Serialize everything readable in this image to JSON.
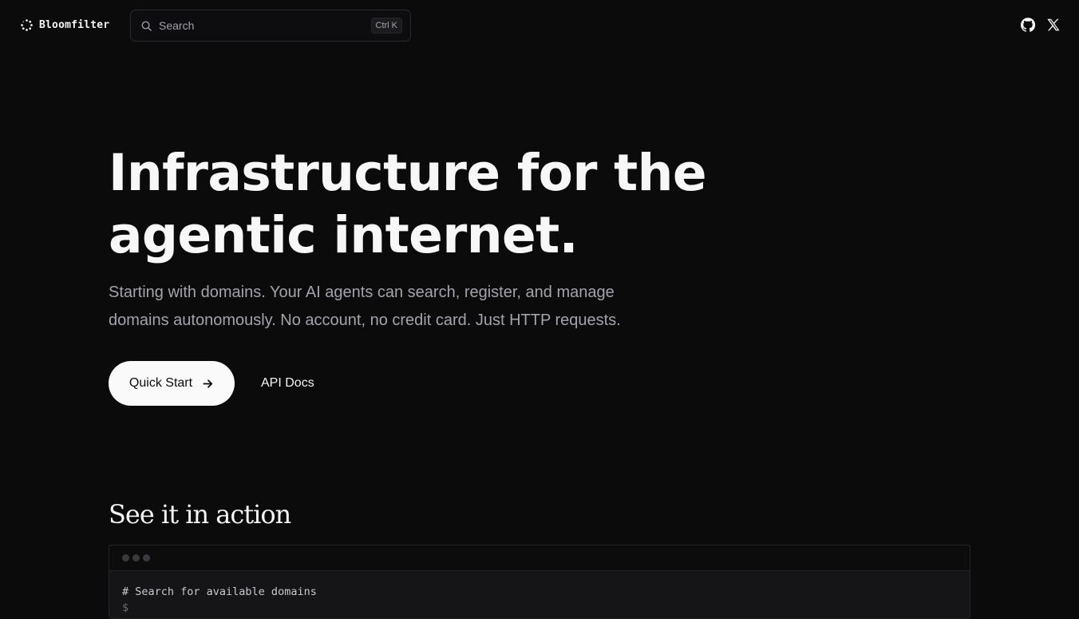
{
  "brand": {
    "name": "Bloomfilter",
    "icon": "dotted-circle-logo"
  },
  "search": {
    "label": "Search",
    "shortcut": "Ctrl K",
    "icon": "search-icon"
  },
  "social": {
    "github": "github-icon",
    "x": "x-icon"
  },
  "hero": {
    "title_line1": "Infrastructure for the",
    "title_line2": "agentic internet.",
    "subtitle_line1": "Starting with domains. Your AI agents can search, register, and manage",
    "subtitle_line2": "domains autonomously. No account, no credit card. Just HTTP requests.",
    "primary_cta": "Quick Start",
    "secondary_cta": "API Docs"
  },
  "demo": {
    "heading": "See it in action",
    "code_lines": [
      "# Search for available domains"
    ]
  },
  "colors": {
    "background": "#0b0b0c",
    "primary_button": "#fafafa",
    "muted_text": "#a3a3ab"
  }
}
